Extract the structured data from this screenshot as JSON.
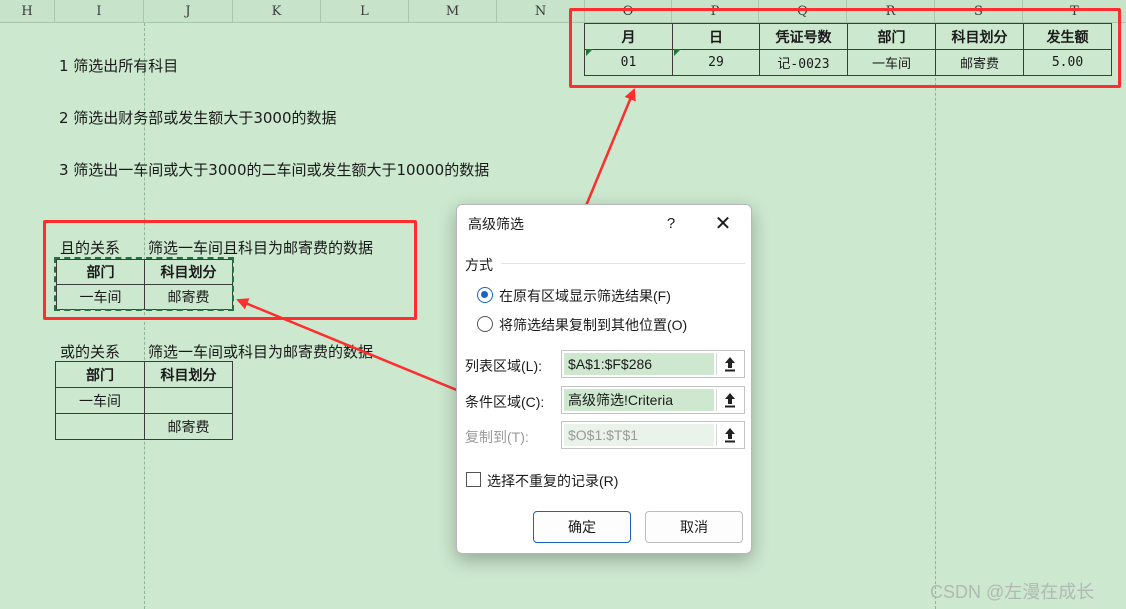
{
  "columns": [
    "H",
    "I",
    "J",
    "K",
    "L",
    "M",
    "N",
    "O",
    "P",
    "Q",
    "R",
    "S",
    "T"
  ],
  "instructions": [
    "1  筛选出所有科目",
    "2  筛选出财务部或发生额大于3000的数据",
    "3  筛选出一车间或大于3000的二车间或发生额大于10000的数据"
  ],
  "and_section": {
    "label": "且的关系",
    "desc": "筛选一车间且科目为邮寄费的数据",
    "headers": [
      "部门",
      "科目划分"
    ],
    "rows": [
      [
        "一车间",
        "邮寄费"
      ]
    ]
  },
  "or_section": {
    "label": "或的关系",
    "desc": "筛选一车间或科目为邮寄费的数据",
    "headers": [
      "部门",
      "科目划分"
    ],
    "rows": [
      [
        "一车间",
        ""
      ],
      [
        "",
        "邮寄费"
      ]
    ]
  },
  "output_table": {
    "headers": [
      "月",
      "日",
      "凭证号数",
      "部门",
      "科目划分",
      "发生额"
    ],
    "row": [
      "01",
      "29",
      "记-0023",
      "一车间",
      "邮寄费",
      "5.00"
    ]
  },
  "dialog": {
    "title": "高级筛选",
    "help": "?",
    "close": "✕",
    "group_label": "方式",
    "option1": "在原有区域显示筛选结果(F)",
    "option2": "将筛选结果复制到其他位置(O)",
    "option_selected": 1,
    "list_label": "列表区域(L):",
    "list_value": "$A$1:$F$286",
    "criteria_label": "条件区域(C):",
    "criteria_value": "高级筛选!Criteria",
    "copy_label": "复制到(T):",
    "copy_value": "$O$1:$T$1",
    "unique_label": "选择不重复的记录(R)",
    "unique_checked": false,
    "ok": "确定",
    "cancel": "取消"
  },
  "colors": {
    "background": "#cce8cf",
    "highlight_red": "#ff2d2d",
    "accent_blue": "#1565c0"
  },
  "watermark": "CSDN @左漫在成长"
}
